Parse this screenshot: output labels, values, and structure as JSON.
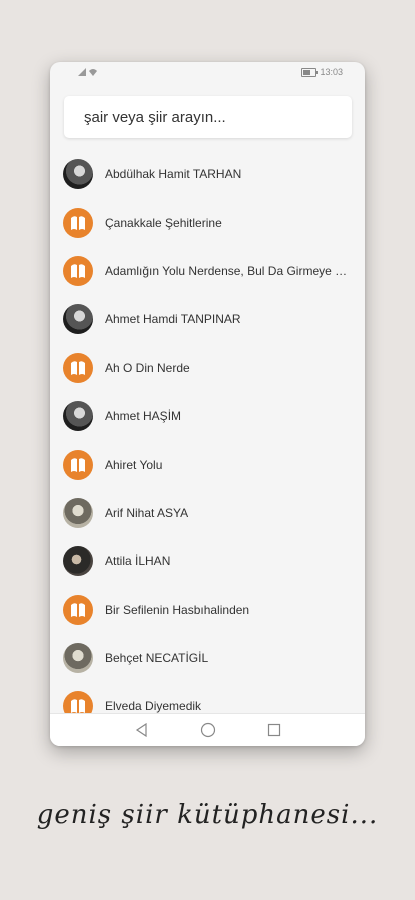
{
  "status_bar": {
    "time": "13:03",
    "icons": [
      "signal-icon",
      "wifi-icon",
      "battery-icon"
    ]
  },
  "search": {
    "placeholder": "şair veya şiir arayın..."
  },
  "list": {
    "items": [
      {
        "label": "Abdülhak Hamit TARHAN",
        "avatar": "photo"
      },
      {
        "label": "Çanakkale Şehitlerine",
        "avatar": "book"
      },
      {
        "label": "Adamlığın Yolu Nerdense, Bul Da Girmeye Bak",
        "avatar": "book"
      },
      {
        "label": "Ahmet Hamdi TANPINAR",
        "avatar": "photo"
      },
      {
        "label": "Ah O Din Nerde",
        "avatar": "book"
      },
      {
        "label": "Ahmet HAŞİM",
        "avatar": "photo"
      },
      {
        "label": "Ahiret Yolu",
        "avatar": "book"
      },
      {
        "label": "Arif Nihat ASYA",
        "avatar": "photo-light"
      },
      {
        "label": "Attila İLHAN",
        "avatar": "photo-dark"
      },
      {
        "label": "Bir Sefilenin Hasbıhalinden",
        "avatar": "book"
      },
      {
        "label": "Behçet NECATİGİL",
        "avatar": "photo-light"
      },
      {
        "label": "Elveda Diyemedik",
        "avatar": "book"
      }
    ]
  },
  "nav_bar": {
    "buttons": [
      "back-icon",
      "home-icon",
      "recents-icon"
    ]
  },
  "tagline": "geniş şiir kütüphanesi...",
  "colors": {
    "accent": "#e8832c",
    "background": "#e8e4e1",
    "card": "#f5f5f5"
  }
}
